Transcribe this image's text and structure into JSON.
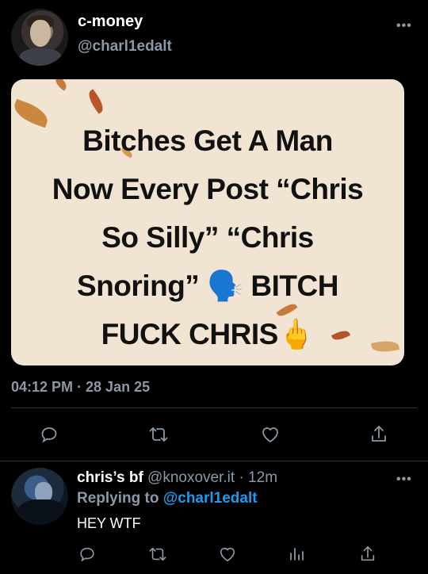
{
  "tweet": {
    "display_name": "c-money",
    "handle": "@charl1edalt",
    "meme_lines": [
      "Bitches Get A Man",
      "Now Every Post “Chris",
      "So Silly” “Chris",
      "Snoring” 🗣️ BITCH",
      "FUCK CHRIS🖕"
    ],
    "timestamp": "04:12 PM · 28 Jan 25"
  },
  "reply": {
    "display_name": "chris’s bf",
    "handle": "@knoxover.it",
    "time_ago": "· 12m",
    "replying_to_prefix": "Replying to",
    "replying_to_handle": "@charl1edalt",
    "text": "HEY WTF"
  },
  "more_glyph": "•••",
  "colors": {
    "background": "#000000",
    "link": "#1d9bf0",
    "muted": "#8b98a5",
    "card": "#f1e4d2"
  }
}
